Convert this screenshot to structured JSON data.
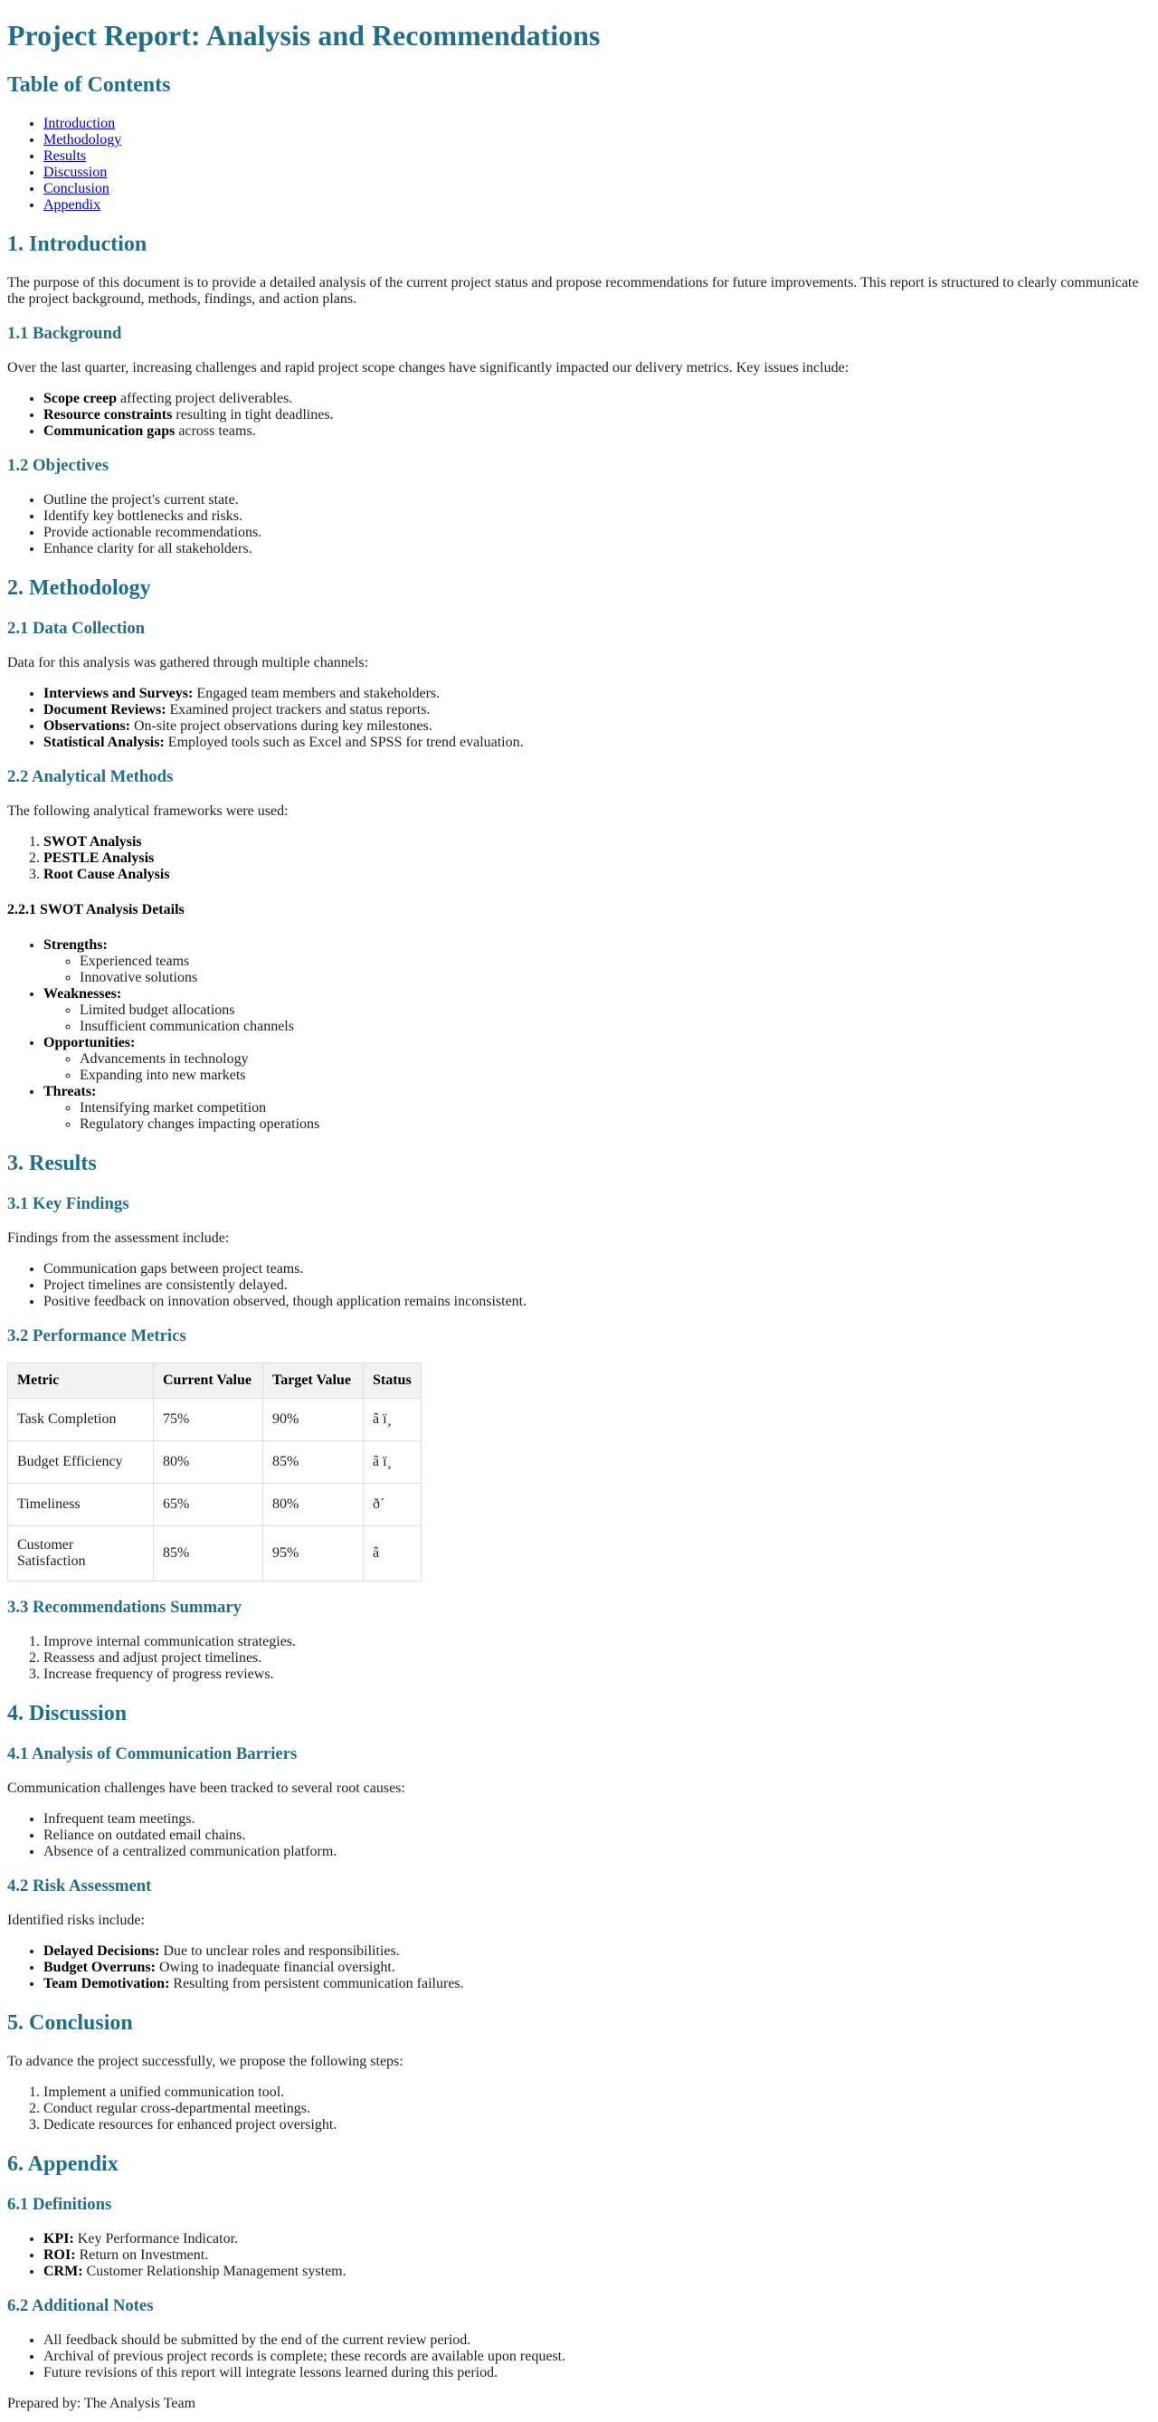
{
  "title": "Project Report: Analysis and Recommendations",
  "toc": {
    "heading": "Table of Contents",
    "items": [
      "Introduction",
      "Methodology",
      "Results",
      "Discussion",
      "Conclusion",
      "Appendix"
    ]
  },
  "intro": {
    "heading": "1. Introduction",
    "text": "The purpose of this document is to provide a detailed analysis of the current project status and propose recommendations for future improvements. This report is structured to clearly communicate the project background, methods, findings, and action plans.",
    "background": {
      "heading": "1.1 Background",
      "text": "Over the last quarter, increasing challenges and rapid project scope changes have significantly impacted our delivery metrics. Key issues include:",
      "items": [
        {
          "b": "Scope creep",
          "t": " affecting project deliverables."
        },
        {
          "b": "Resource constraints",
          "t": " resulting in tight deadlines."
        },
        {
          "b": "Communication gaps",
          "t": " across teams."
        }
      ]
    },
    "objectives": {
      "heading": "1.2 Objectives",
      "items": [
        "Outline the project's current state.",
        "Identify key bottlenecks and risks.",
        "Provide actionable recommendations.",
        "Enhance clarity for all stakeholders."
      ]
    }
  },
  "methodology": {
    "heading": "2. Methodology",
    "data_collection": {
      "heading": "2.1 Data Collection",
      "text": "Data for this analysis was gathered through multiple channels:",
      "items": [
        {
          "b": "Interviews and Surveys:",
          "t": " Engaged team members and stakeholders."
        },
        {
          "b": "Document Reviews:",
          "t": " Examined project trackers and status reports."
        },
        {
          "b": "Observations:",
          "t": " On-site project observations during key milestones."
        },
        {
          "b": "Statistical Analysis:",
          "t": " Employed tools such as Excel and SPSS for trend evaluation."
        }
      ]
    },
    "analytical": {
      "heading": "2.2 Analytical Methods",
      "text": "The following analytical frameworks were used:",
      "items": [
        "SWOT Analysis",
        "PESTLE Analysis",
        "Root Cause Analysis"
      ]
    },
    "swot": {
      "heading": "2.2.1 SWOT Analysis Details",
      "groups": [
        {
          "label": "Strengths:",
          "items": [
            "Experienced teams",
            "Innovative solutions"
          ]
        },
        {
          "label": "Weaknesses:",
          "items": [
            "Limited budget allocations",
            "Insufficient communication channels"
          ]
        },
        {
          "label": "Opportunities:",
          "items": [
            "Advancements in technology",
            "Expanding into new markets"
          ]
        },
        {
          "label": "Threats:",
          "items": [
            "Intensifying market competition",
            "Regulatory changes impacting operations"
          ]
        }
      ]
    }
  },
  "results": {
    "heading": "3. Results",
    "findings": {
      "heading": "3.1 Key Findings",
      "text": "Findings from the assessment include:",
      "items": [
        "Communication gaps between project teams.",
        "Project timelines are consistently delayed.",
        "Positive feedback on innovation observed, though application remains inconsistent."
      ]
    },
    "metrics": {
      "heading": "3.2 Performance Metrics",
      "columns": [
        "Metric",
        "Current Value",
        "Target Value",
        "Status"
      ],
      "rows": [
        [
          "Task Completion",
          "75%",
          "90%",
          "â ï¸"
        ],
        [
          "Budget Efficiency",
          "80%",
          "85%",
          "â ï¸"
        ],
        [
          "Timeliness",
          "65%",
          "80%",
          "ð´"
        ],
        [
          "Customer Satisfaction",
          "85%",
          "95%",
          "â"
        ]
      ]
    },
    "recommendations": {
      "heading": "3.3 Recommendations Summary",
      "items": [
        "Improve internal communication strategies.",
        "Reassess and adjust project timelines.",
        "Increase frequency of progress reviews."
      ]
    }
  },
  "discussion": {
    "heading": "4. Discussion",
    "barriers": {
      "heading": "4.1 Analysis of Communication Barriers",
      "text": "Communication challenges have been tracked to several root causes:",
      "items": [
        "Infrequent team meetings.",
        "Reliance on outdated email chains.",
        "Absence of a centralized communication platform."
      ]
    },
    "risk": {
      "heading": "4.2 Risk Assessment",
      "text": "Identified risks include:",
      "items": [
        {
          "b": "Delayed Decisions:",
          "t": " Due to unclear roles and responsibilities."
        },
        {
          "b": "Budget Overruns:",
          "t": " Owing to inadequate financial oversight."
        },
        {
          "b": "Team Demotivation:",
          "t": " Resulting from persistent communication failures."
        }
      ]
    }
  },
  "conclusion": {
    "heading": "5. Conclusion",
    "text": "To advance the project successfully, we propose the following steps:",
    "items": [
      "Implement a unified communication tool.",
      "Conduct regular cross-departmental meetings.",
      "Dedicate resources for enhanced project oversight."
    ]
  },
  "appendix": {
    "heading": "6. Appendix",
    "definitions": {
      "heading": "6.1 Definitions",
      "items": [
        {
          "b": "KPI:",
          "t": " Key Performance Indicator."
        },
        {
          "b": "ROI:",
          "t": " Return on Investment."
        },
        {
          "b": "CRM:",
          "t": " Customer Relationship Management system."
        }
      ]
    },
    "notes": {
      "heading": "6.2 Additional Notes",
      "items": [
        "All feedback should be submitted by the end of the current review period.",
        "Archival of previous project records is complete; these records are available upon request.",
        "Future revisions of this report will integrate lessons learned during this period."
      ]
    }
  },
  "footer": "Prepared by: The Analysis Team"
}
